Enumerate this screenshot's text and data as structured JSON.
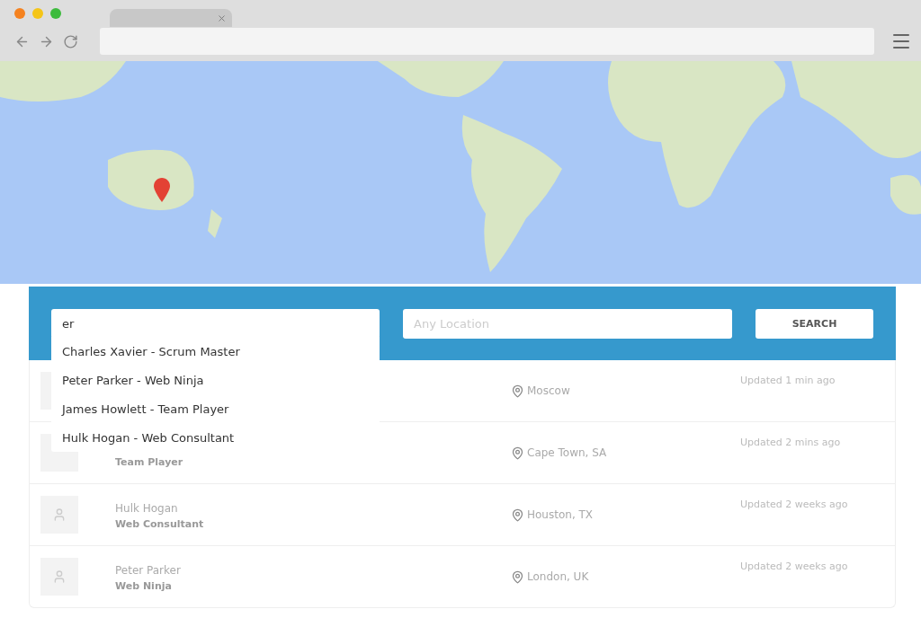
{
  "search": {
    "keyword": {
      "value": "er"
    },
    "location": {
      "placeholder": "Any Location"
    },
    "button": "SEARCH",
    "suggestions": [
      "Charles Xavier - Scrum Master",
      "Peter Parker - Web Ninja",
      "James Howlett - Team Player",
      "Hulk Hogan - Web Consultant"
    ]
  },
  "results": [
    {
      "location": "Moscow",
      "updated": "Updated 1 min ago"
    },
    {
      "role": "Team Player",
      "location": "Cape Town, SA",
      "updated": "Updated 2 mins ago"
    },
    {
      "name": "Hulk Hogan",
      "role": "Web Consultant",
      "location": "Houston, TX",
      "updated": "Updated 2 weeks ago"
    },
    {
      "name": "Peter Parker",
      "role": "Web Ninja",
      "location": "London, UK",
      "updated": "Updated 2 weeks ago"
    }
  ]
}
